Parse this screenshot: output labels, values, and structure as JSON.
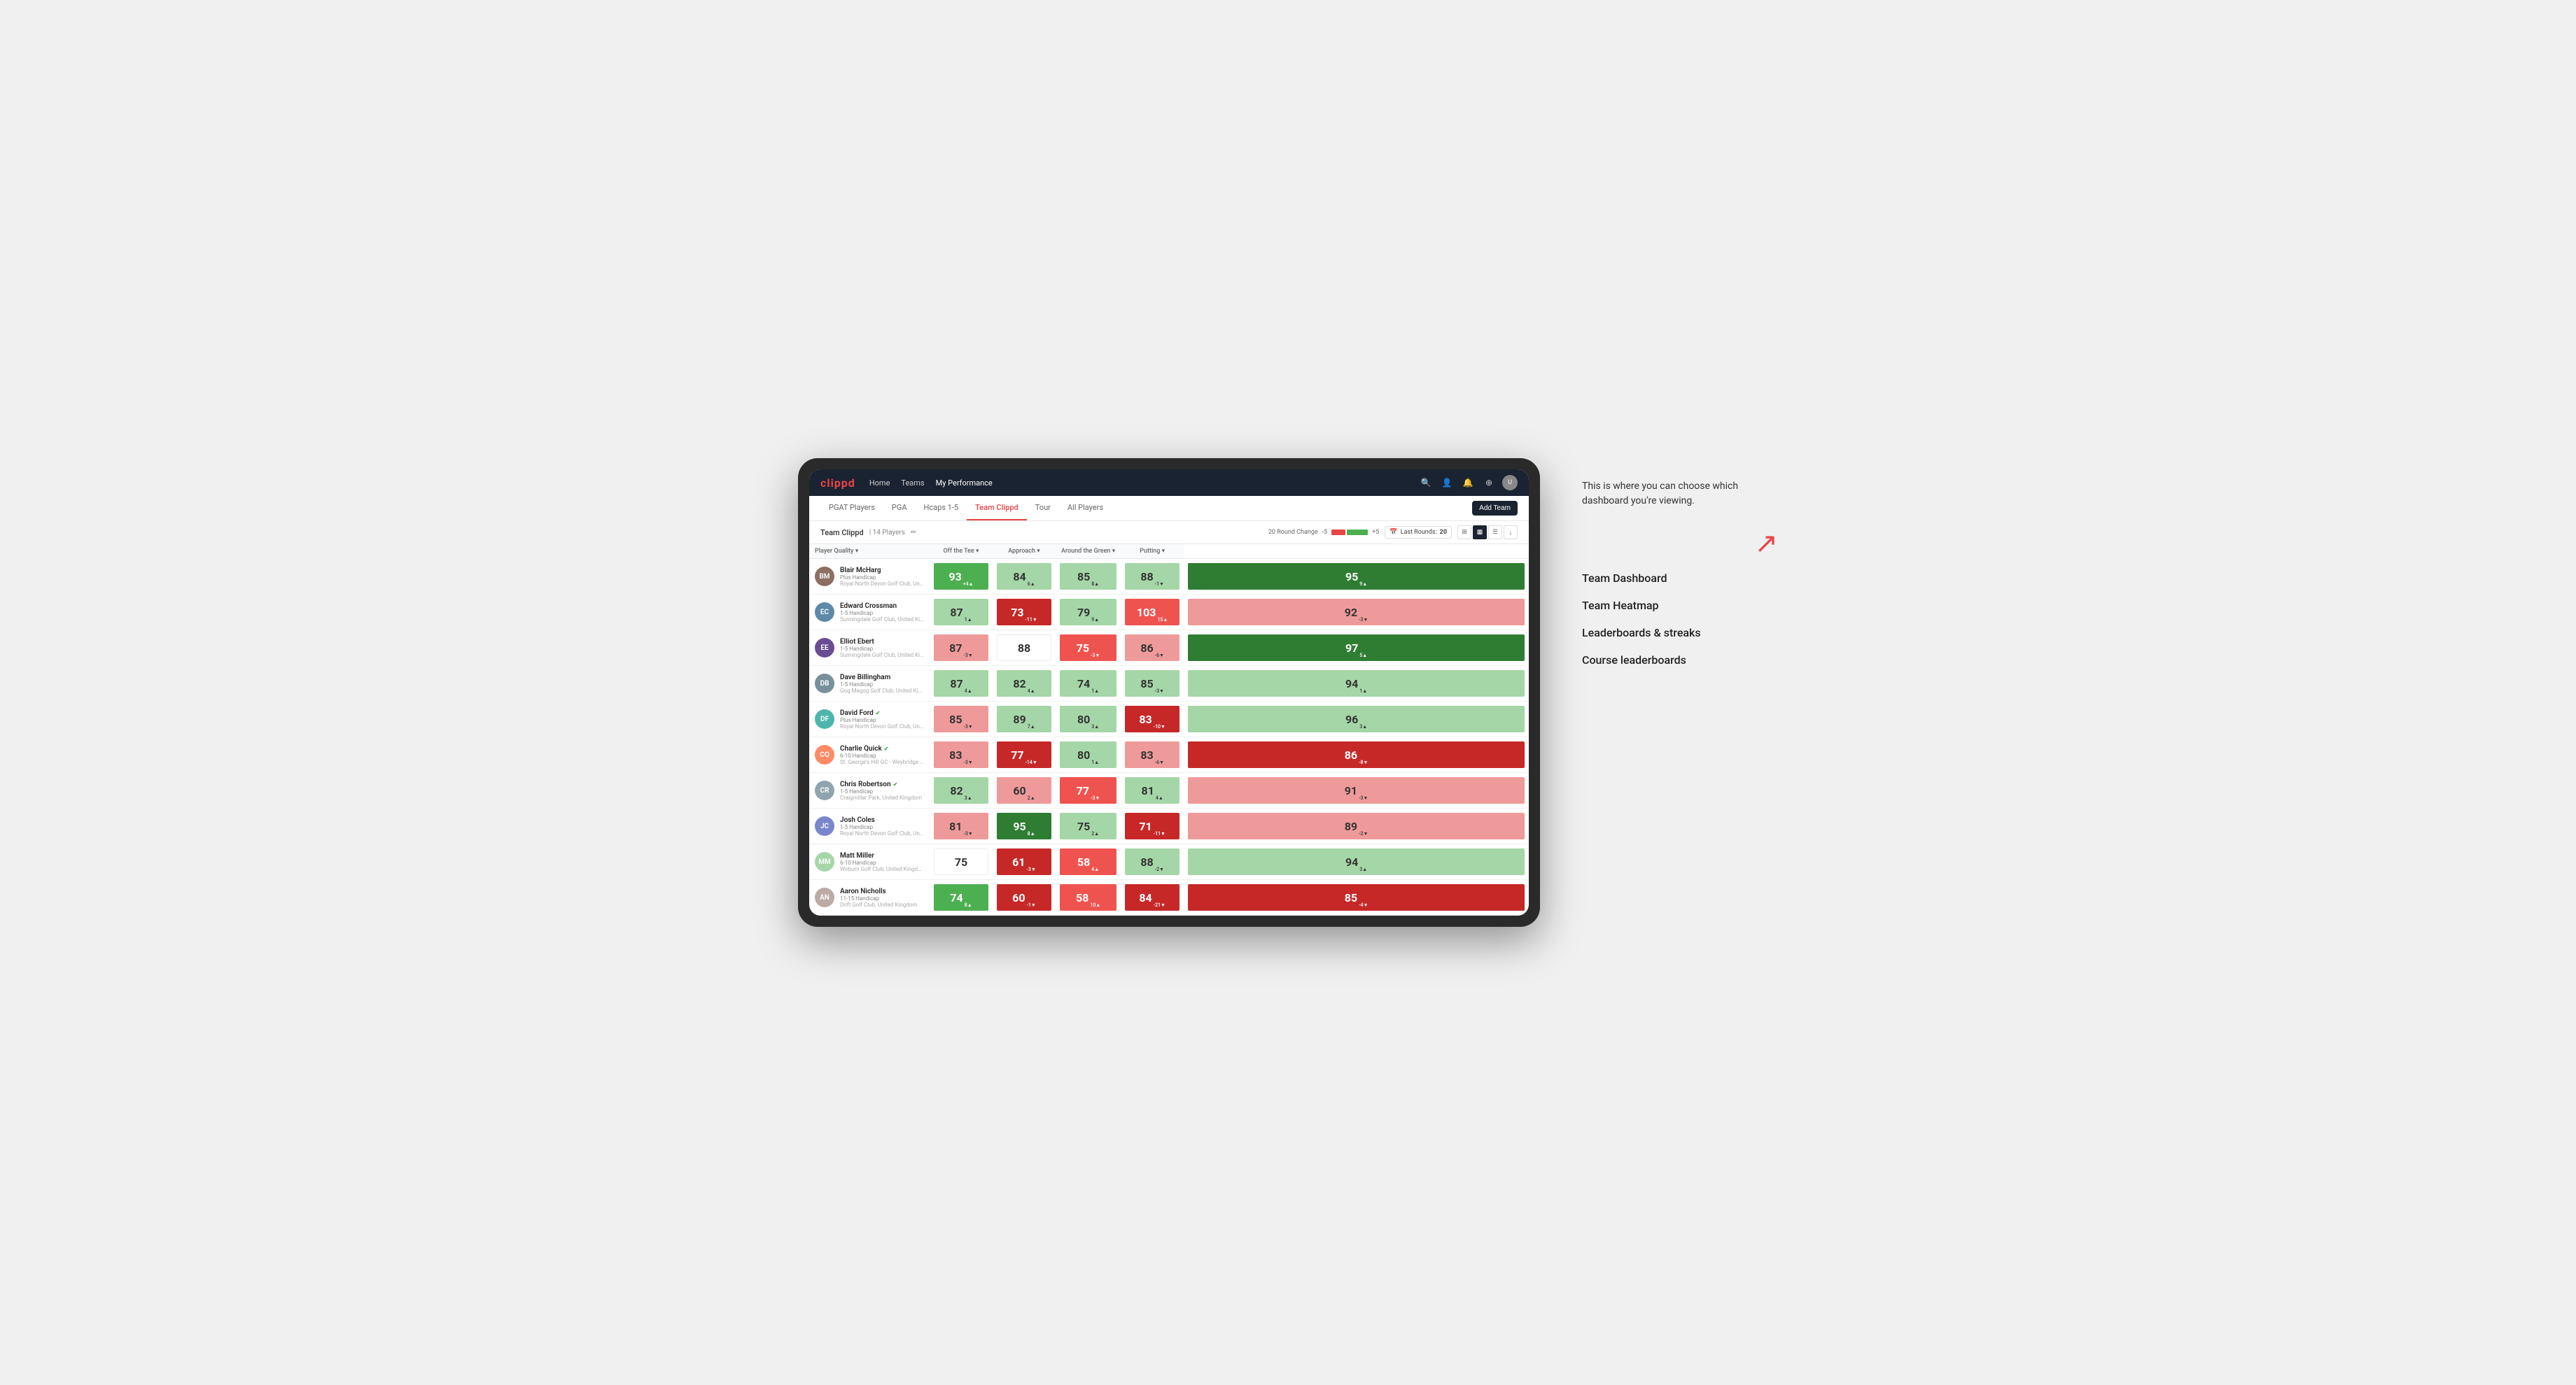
{
  "annotation": {
    "intro_text": "This is where you can choose which dashboard you're viewing.",
    "options": [
      "Team Dashboard",
      "Team Heatmap",
      "Leaderboards & streaks",
      "Course leaderboards"
    ]
  },
  "nav": {
    "logo": "clippd",
    "links": [
      {
        "label": "Home",
        "active": false
      },
      {
        "label": "Teams",
        "active": false
      },
      {
        "label": "My Performance",
        "active": true
      }
    ],
    "icons": [
      "search",
      "person",
      "bell",
      "circle-plus",
      "avatar"
    ]
  },
  "sub_tabs": [
    {
      "label": "PGAT Players",
      "active": false
    },
    {
      "label": "PGA",
      "active": false
    },
    {
      "label": "Hcaps 1-5",
      "active": false
    },
    {
      "label": "Team Clippd",
      "active": true
    },
    {
      "label": "Tour",
      "active": false
    },
    {
      "label": "All Players",
      "active": false
    }
  ],
  "add_team_label": "Add Team",
  "team_info": {
    "name": "Team Clippd",
    "separator": "|",
    "count": "14 Players"
  },
  "controls": {
    "round_change_label": "20 Round Change",
    "neg_label": "-5",
    "pos_label": "+5",
    "last_rounds_label": "Last Rounds:",
    "last_rounds_value": "20"
  },
  "columns": {
    "player_quality": "Player Quality ▾",
    "off_tee": "Off the Tee ▾",
    "approach": "Approach ▾",
    "around_green": "Around the Green ▾",
    "putting": "Putting ▾"
  },
  "players": [
    {
      "name": "Blair McHarg",
      "handicap": "Plus Handicap",
      "club": "Royal North Devon Golf Club, United Kingdom",
      "initials": "BM",
      "avatar_color": "#8d6e63",
      "scores": [
        {
          "value": 93,
          "change": "+4",
          "direction": "up",
          "bg": "bg-green-med"
        },
        {
          "value": 84,
          "change": "6",
          "direction": "up",
          "bg": "bg-green-light"
        },
        {
          "value": 85,
          "change": "8",
          "direction": "up",
          "bg": "bg-green-light"
        },
        {
          "value": 88,
          "change": "-1",
          "direction": "down",
          "bg": "bg-green-light"
        },
        {
          "value": 95,
          "change": "9",
          "direction": "up",
          "bg": "bg-green-dark"
        }
      ]
    },
    {
      "name": "Edward Crossman",
      "handicap": "1-5 Handicap",
      "club": "Sunningdale Golf Club, United Kingdom",
      "initials": "EC",
      "avatar_color": "#5d8aa8",
      "scores": [
        {
          "value": 87,
          "change": "1",
          "direction": "up",
          "bg": "bg-green-light"
        },
        {
          "value": 73,
          "change": "-11",
          "direction": "down",
          "bg": "bg-red-dark"
        },
        {
          "value": 79,
          "change": "9",
          "direction": "up",
          "bg": "bg-green-light"
        },
        {
          "value": 103,
          "change": "15",
          "direction": "up",
          "bg": "bg-red-med"
        },
        {
          "value": 92,
          "change": "-3",
          "direction": "down",
          "bg": "bg-red-light"
        }
      ]
    },
    {
      "name": "Elliot Ebert",
      "handicap": "1-5 Handicap",
      "club": "Sunningdale Golf Club, United Kingdom",
      "initials": "EE",
      "avatar_color": "#6a4c93",
      "scores": [
        {
          "value": 87,
          "change": "-3",
          "direction": "down",
          "bg": "bg-red-light"
        },
        {
          "value": 88,
          "change": "",
          "direction": "",
          "bg": "bg-white"
        },
        {
          "value": 75,
          "change": "-3",
          "direction": "down",
          "bg": "bg-red-med"
        },
        {
          "value": 86,
          "change": "-6",
          "direction": "down",
          "bg": "bg-red-light"
        },
        {
          "value": 97,
          "change": "5",
          "direction": "up",
          "bg": "bg-green-dark"
        }
      ]
    },
    {
      "name": "Dave Billingham",
      "handicap": "1-5 Handicap",
      "club": "Gog Magog Golf Club, United Kingdom",
      "initials": "DB",
      "avatar_color": "#78909c",
      "scores": [
        {
          "value": 87,
          "change": "4",
          "direction": "up",
          "bg": "bg-green-light"
        },
        {
          "value": 82,
          "change": "4",
          "direction": "up",
          "bg": "bg-green-light"
        },
        {
          "value": 74,
          "change": "1",
          "direction": "up",
          "bg": "bg-green-light"
        },
        {
          "value": 85,
          "change": "-3",
          "direction": "down",
          "bg": "bg-green-light"
        },
        {
          "value": 94,
          "change": "1",
          "direction": "up",
          "bg": "bg-green-light"
        }
      ]
    },
    {
      "name": "David Ford",
      "handicap": "Plus Handicap",
      "club": "Royal North Devon Golf Club, United Kingdom",
      "initials": "DF",
      "avatar_color": "#4db6ac",
      "verified": true,
      "scores": [
        {
          "value": 85,
          "change": "-3",
          "direction": "down",
          "bg": "bg-red-light"
        },
        {
          "value": 89,
          "change": "7",
          "direction": "up",
          "bg": "bg-green-light"
        },
        {
          "value": 80,
          "change": "3",
          "direction": "up",
          "bg": "bg-green-light"
        },
        {
          "value": 83,
          "change": "-10",
          "direction": "down",
          "bg": "bg-red-dark"
        },
        {
          "value": 96,
          "change": "3",
          "direction": "up",
          "bg": "bg-green-light"
        }
      ]
    },
    {
      "name": "Charlie Quick",
      "handicap": "6-10 Handicap",
      "club": "St. George's Hill GC - Weybridge - Surrey, Uni...",
      "initials": "CQ",
      "avatar_color": "#ff8a65",
      "verified": true,
      "scores": [
        {
          "value": 83,
          "change": "-3",
          "direction": "down",
          "bg": "bg-red-light"
        },
        {
          "value": 77,
          "change": "-14",
          "direction": "down",
          "bg": "bg-red-dark"
        },
        {
          "value": 80,
          "change": "1",
          "direction": "up",
          "bg": "bg-green-light"
        },
        {
          "value": 83,
          "change": "-6",
          "direction": "down",
          "bg": "bg-red-light"
        },
        {
          "value": 86,
          "change": "-8",
          "direction": "down",
          "bg": "bg-red-dark"
        }
      ]
    },
    {
      "name": "Chris Robertson",
      "handicap": "1-5 Handicap",
      "club": "Craigmillar Park, United Kingdom",
      "initials": "CR",
      "avatar_color": "#90a4ae",
      "verified": true,
      "scores": [
        {
          "value": 82,
          "change": "3",
          "direction": "up",
          "bg": "bg-green-light"
        },
        {
          "value": 60,
          "change": "2",
          "direction": "up",
          "bg": "bg-red-light"
        },
        {
          "value": 77,
          "change": "-3",
          "direction": "down",
          "bg": "bg-red-med"
        },
        {
          "value": 81,
          "change": "4",
          "direction": "up",
          "bg": "bg-green-light"
        },
        {
          "value": 91,
          "change": "-3",
          "direction": "down",
          "bg": "bg-red-light"
        }
      ]
    },
    {
      "name": "Josh Coles",
      "handicap": "1-5 Handicap",
      "club": "Royal North Devon Golf Club, United Kingdom",
      "initials": "JC",
      "avatar_color": "#7986cb",
      "scores": [
        {
          "value": 81,
          "change": "-3",
          "direction": "down",
          "bg": "bg-red-light"
        },
        {
          "value": 95,
          "change": "8",
          "direction": "up",
          "bg": "bg-green-dark"
        },
        {
          "value": 75,
          "change": "2",
          "direction": "up",
          "bg": "bg-green-light"
        },
        {
          "value": 71,
          "change": "-11",
          "direction": "down",
          "bg": "bg-red-dark"
        },
        {
          "value": 89,
          "change": "-2",
          "direction": "down",
          "bg": "bg-red-light"
        }
      ]
    },
    {
      "name": "Matt Miller",
      "handicap": "6-10 Handicap",
      "club": "Woburn Golf Club, United Kingdom",
      "initials": "MM",
      "avatar_color": "#a5d6a7",
      "scores": [
        {
          "value": 75,
          "change": "",
          "direction": "",
          "bg": "bg-white"
        },
        {
          "value": 61,
          "change": "-3",
          "direction": "down",
          "bg": "bg-red-dark"
        },
        {
          "value": 58,
          "change": "4",
          "direction": "up",
          "bg": "bg-red-med"
        },
        {
          "value": 88,
          "change": "-2",
          "direction": "down",
          "bg": "bg-green-light"
        },
        {
          "value": 94,
          "change": "3",
          "direction": "up",
          "bg": "bg-green-light"
        }
      ]
    },
    {
      "name": "Aaron Nicholls",
      "handicap": "11-15 Handicap",
      "club": "Drift Golf Club, United Kingdom",
      "initials": "AN",
      "avatar_color": "#bcaaa4",
      "scores": [
        {
          "value": 74,
          "change": "8",
          "direction": "up",
          "bg": "bg-green-med"
        },
        {
          "value": 60,
          "change": "-1",
          "direction": "down",
          "bg": "bg-red-dark"
        },
        {
          "value": 58,
          "change": "10",
          "direction": "up",
          "bg": "bg-red-med"
        },
        {
          "value": 84,
          "change": "-21",
          "direction": "down",
          "bg": "bg-red-dark"
        },
        {
          "value": 85,
          "change": "-4",
          "direction": "down",
          "bg": "bg-red-dark"
        }
      ]
    }
  ]
}
